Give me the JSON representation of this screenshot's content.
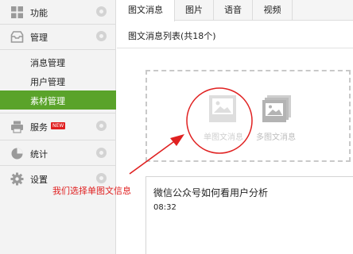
{
  "sidebar": {
    "sections": {
      "function": {
        "label": "功能"
      },
      "manage": {
        "label": "管理"
      },
      "service": {
        "label": "服务",
        "badge": "NEW"
      },
      "stats": {
        "label": "统计"
      },
      "settings": {
        "label": "设置"
      }
    },
    "sub_items": [
      {
        "label": "消息管理"
      },
      {
        "label": "用户管理"
      },
      {
        "label": "素材管理",
        "active": true
      }
    ]
  },
  "tabs": [
    {
      "label": "图文消息",
      "active": true
    },
    {
      "label": "图片"
    },
    {
      "label": "语音"
    },
    {
      "label": "视频"
    }
  ],
  "list_title": "图文消息列表(共18个)",
  "create_options": {
    "single": "单图文消息",
    "multi": "多图文消息"
  },
  "message": {
    "title": "微信公众号如何看用户分析",
    "time": "08:32"
  },
  "annotation": {
    "text": "我们选择单图文信息",
    "color": "#e02020"
  },
  "colors": {
    "active_green": "#5aa32a",
    "annotation_red": "#e02020"
  }
}
